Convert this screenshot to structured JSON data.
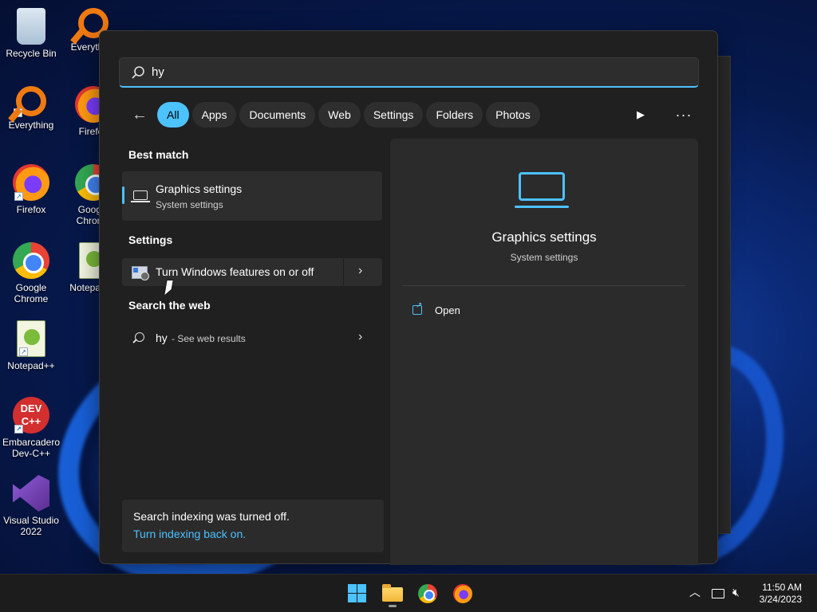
{
  "desktop": {
    "icons": [
      {
        "label": "Recycle Bin"
      },
      {
        "label": "Everything"
      },
      {
        "label": "Everything"
      },
      {
        "label": "Firefox"
      },
      {
        "label": "Firefox"
      },
      {
        "label": "Google Chrome"
      },
      {
        "label": "Google Chrome"
      },
      {
        "label": "Notepad++"
      },
      {
        "label": "Notepad++"
      },
      {
        "label": "Embarcadero Dev-C++"
      },
      {
        "label": "Visual Studio 2022"
      }
    ],
    "dev_badge": "DEV C++"
  },
  "search": {
    "query": "hy",
    "filters": [
      "All",
      "Apps",
      "Documents",
      "Web",
      "Settings",
      "Folders",
      "Photos"
    ],
    "active_filter": "All",
    "sections": {
      "best_match": "Best match",
      "settings": "Settings",
      "web": "Search the web"
    },
    "best_match": {
      "title": "Graphics settings",
      "subtitle": "System settings"
    },
    "settings_result": {
      "title": "Turn Windows features on or off"
    },
    "web_result": {
      "query": "hy",
      "suffix": "- See web results"
    },
    "indexing": {
      "message": "Search indexing was turned off.",
      "link": "Turn indexing back on."
    },
    "preview": {
      "title": "Graphics settings",
      "subtitle": "System settings",
      "action": "Open"
    }
  },
  "taskbar": {
    "time": "11:50 AM",
    "date": "3/24/2023"
  },
  "colors": {
    "accent": "#4cc2ff",
    "panel": "#202020",
    "card": "#2d2d2d"
  }
}
